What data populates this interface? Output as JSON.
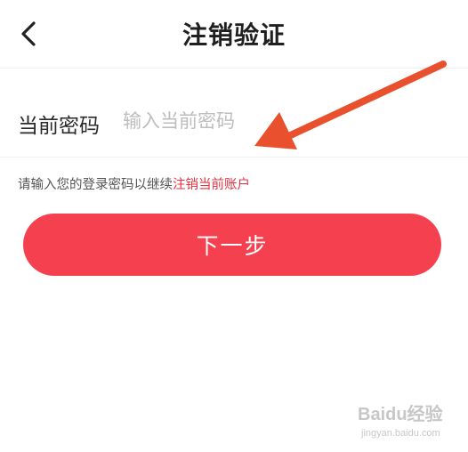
{
  "header": {
    "back_icon": "chevron-left-icon",
    "title": "注销验证"
  },
  "form": {
    "label": "当前密码",
    "placeholder": "输入当前密码",
    "value": ""
  },
  "hint": {
    "prefix": "请输入您的登录密码以继续",
    "link": "注销当前账户",
    "link_color": "#e7303f"
  },
  "button": {
    "label": "下一步",
    "color": "#f5404f"
  },
  "annotation": {
    "arrow_color": "#e8502e",
    "arrow_icon": "red-arrow-annotation"
  },
  "watermark": {
    "logo_icon": "baidu-jingyan-watermark",
    "text": "Baidu经验",
    "url": "jingyan.baidu.com"
  }
}
